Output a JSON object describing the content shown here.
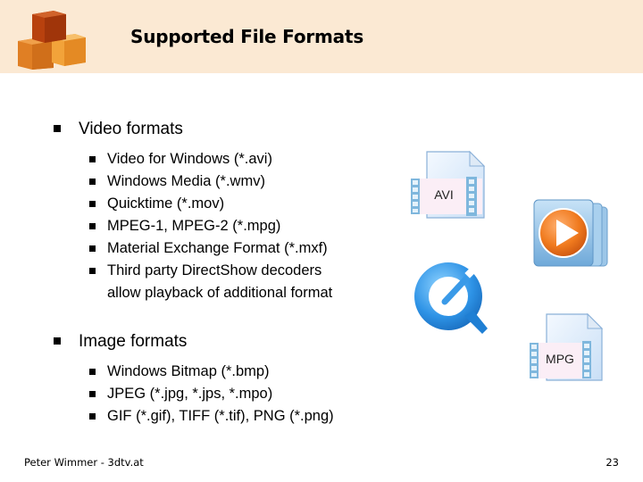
{
  "slide": {
    "title": "Supported File Formats",
    "sections": [
      {
        "label": "Video formats",
        "items": [
          "Video for Windows (*.avi)",
          "Windows Media (*.wmv)",
          "Quicktime (*.mov)",
          "MPEG-1, MPEG-2 (*.mpg)",
          "Material Exchange Format (*.mxf)",
          "Third party DirectShow decoders",
          "allow playback of additional format"
        ]
      },
      {
        "label": "Image formats",
        "items": [
          "Windows Bitmap (*.bmp)",
          "JPEG (*.jpg, *.jps, *.mpo)",
          "GIF (*.gif), TIFF (*.tif), PNG (*.png)"
        ]
      }
    ],
    "icons": {
      "avi_label": "AVI",
      "mpg_label": "MPG"
    },
    "footer": {
      "author": "Peter Wimmer - 3dtv.at",
      "page_number": "23"
    },
    "colors": {
      "header_bg": "#fbe9d3",
      "cube_dark": "#b8410e",
      "cube_mid": "#e07f24",
      "cube_light": "#f2a33a"
    }
  }
}
